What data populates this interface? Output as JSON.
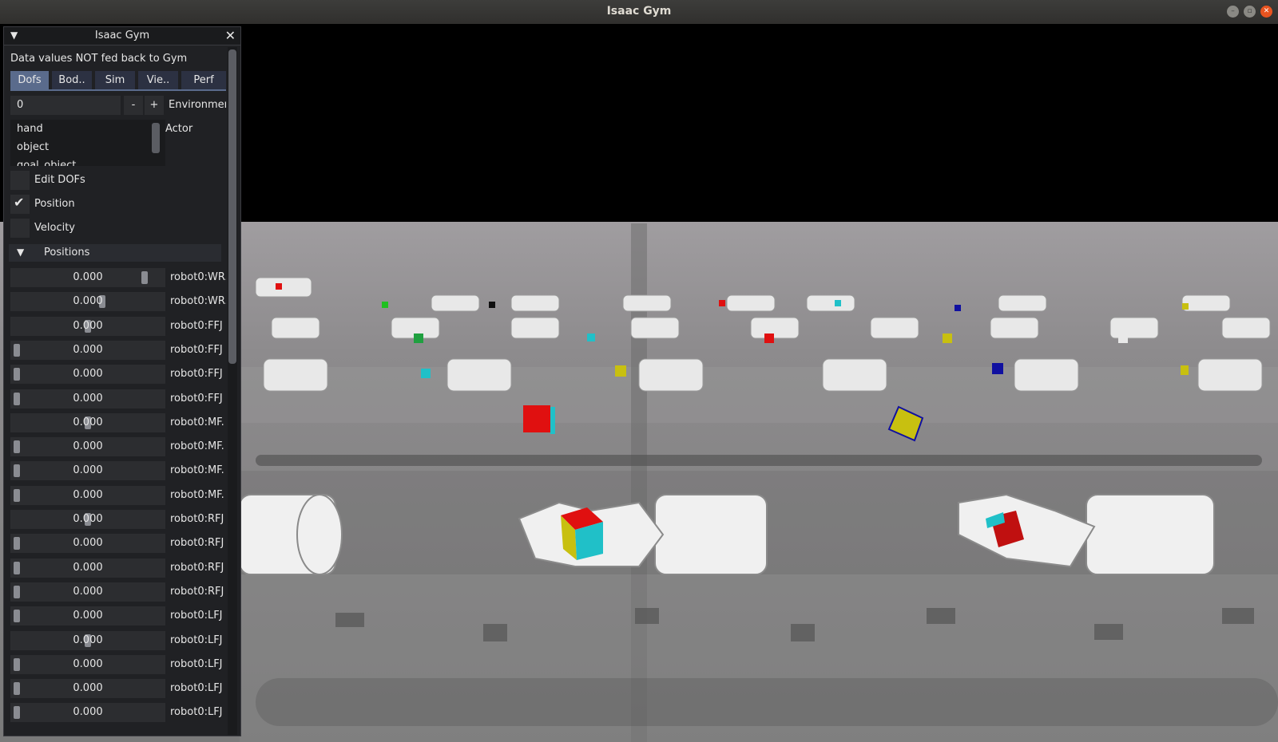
{
  "window": {
    "title": "Isaac Gym"
  },
  "panel": {
    "title": "Isaac Gym",
    "note": "Data values NOT fed back to Gym",
    "tabs": [
      "Dofs",
      "Bod..",
      "Sim",
      "Vie..",
      "Perf"
    ],
    "active_tab": "Dofs",
    "environment": {
      "value": "0",
      "minus": "-",
      "plus": "+",
      "label": "Environmen"
    },
    "actor_label": "Actor",
    "actors": [
      "hand",
      "object",
      "goal_object"
    ],
    "checkboxes": [
      {
        "label": "Edit DOFs",
        "checked": false
      },
      {
        "label": "Position",
        "checked": true
      },
      {
        "label": "Velocity",
        "checked": false
      }
    ],
    "positions_title": "Positions",
    "dofs": [
      {
        "value": "0.000",
        "name": "robot0:WR.",
        "level": 0.9
      },
      {
        "value": "0.000",
        "name": "robot0:WR.",
        "level": 0.6
      },
      {
        "value": "0.000",
        "name": "robot0:FFJ",
        "level": 0.5
      },
      {
        "value": "0.000",
        "name": "robot0:FFJ",
        "level": 0.0
      },
      {
        "value": "0.000",
        "name": "robot0:FFJ",
        "level": 0.0
      },
      {
        "value": "0.000",
        "name": "robot0:FFJ",
        "level": 0.0
      },
      {
        "value": "0.000",
        "name": "robot0:MF.",
        "level": 0.5
      },
      {
        "value": "0.000",
        "name": "robot0:MF.",
        "level": 0.0
      },
      {
        "value": "0.000",
        "name": "robot0:MF.",
        "level": 0.0
      },
      {
        "value": "0.000",
        "name": "robot0:MF.",
        "level": 0.0
      },
      {
        "value": "0.000",
        "name": "robot0:RFJ",
        "level": 0.5
      },
      {
        "value": "0.000",
        "name": "robot0:RFJ",
        "level": 0.0
      },
      {
        "value": "0.000",
        "name": "robot0:RFJ",
        "level": 0.0
      },
      {
        "value": "0.000",
        "name": "robot0:RFJ",
        "level": 0.0
      },
      {
        "value": "0.000",
        "name": "robot0:LFJ",
        "level": 0.0
      },
      {
        "value": "0.000",
        "name": "robot0:LFJ",
        "level": 0.5
      },
      {
        "value": "0.000",
        "name": "robot0:LFJ",
        "level": 0.0
      },
      {
        "value": "0.000",
        "name": "robot0:LFJ",
        "level": 0.0
      },
      {
        "value": "0.000",
        "name": "robot0:LFJ",
        "level": 0.0
      }
    ]
  },
  "colors": {
    "accent": "#5a6b8c",
    "sky": "#000000",
    "ground": "#8c8c8c",
    "cube_red": "#e01010",
    "cube_yellow": "#c8c010",
    "cube_cyan": "#20c0c8"
  }
}
